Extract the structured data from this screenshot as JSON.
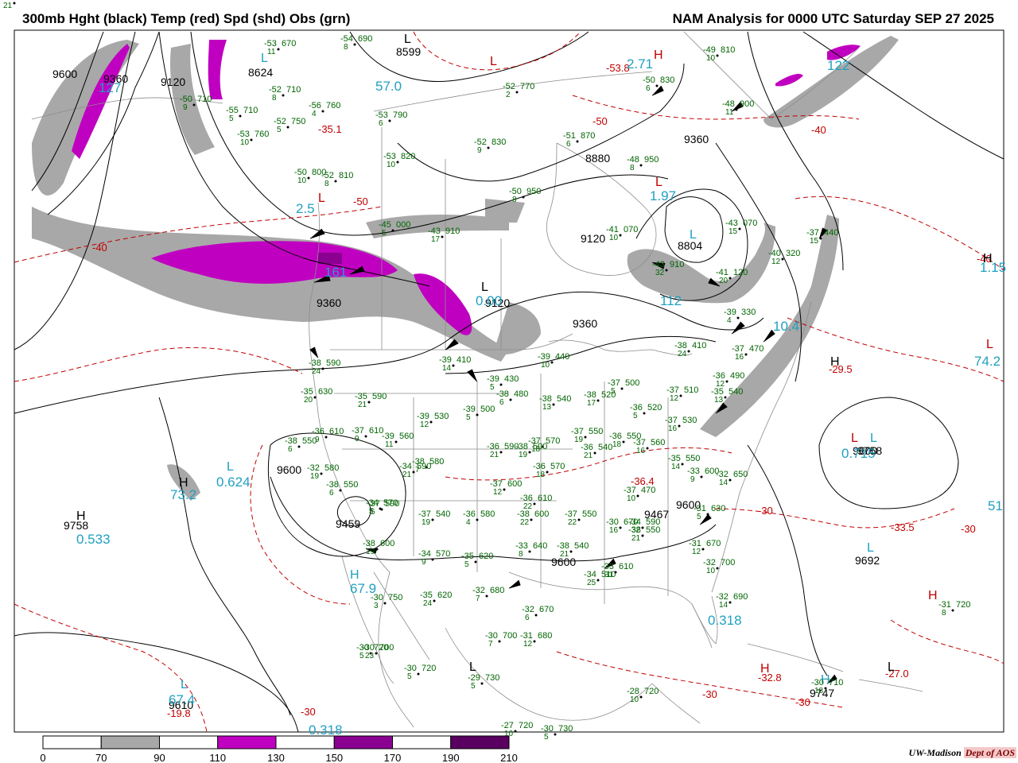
{
  "header": {
    "title_left": "300mb Hght (black) Temp (red) Spd (shd) Obs (grn)",
    "title_right": "NAM Analysis for 0000 UTC Saturday  SEP 27 2025"
  },
  "colorbar": {
    "ticks": [
      "0",
      "70",
      "90",
      "110",
      "130",
      "150",
      "170",
      "190",
      "210"
    ],
    "fills": [
      "#ffffff",
      "#a8a8a8",
      "#ffffff",
      "#c000c0",
      "#ffffff",
      "#8a0090",
      "#ffffff",
      "#5a0060"
    ]
  },
  "credit": {
    "org": "UW-Madison",
    "dept": "Dept of AOS"
  },
  "colors": {
    "height": "#000000",
    "temp": "#c00000",
    "obs": "#006400",
    "speed_label": "#20a0c0",
    "speed_90": "#a8a8a8",
    "speed_110": "#c000c0",
    "speed_150": "#8a0090"
  },
  "height_labels": [
    "9600",
    "9360",
    "9120",
    "8624",
    "8599",
    "8880",
    "9120",
    "9360",
    "8804",
    "9120",
    "9360",
    "9360",
    "9600",
    "9758",
    "9459",
    "9600",
    "9467",
    "9600",
    "9692",
    "9758",
    "9610",
    "9747",
    "9600"
  ],
  "temp_labels": [
    "-40",
    "-40",
    "-40",
    "-50",
    "-53.8",
    "-50",
    "-35.1",
    "-29.5",
    "-30",
    "-33.5",
    "-30",
    "-32.8",
    "-27.0",
    "-30",
    "-30",
    "-30",
    "-19.8",
    "-36.4"
  ],
  "speed_labels": [
    "57.0",
    "127",
    "2.71",
    "122",
    "1.97",
    "112",
    "1.15",
    "74.2",
    "0.624",
    "73.2",
    "0.533",
    "67.9",
    "0.318",
    "0.318",
    "0.715",
    "67.4",
    "51",
    "2.5",
    "161",
    "0.00",
    "10.4"
  ],
  "pressure_centers": [
    "H",
    "L",
    "L",
    "L",
    "H",
    "L",
    "H",
    "L",
    "L",
    "H",
    "L",
    "H",
    "L",
    "L",
    "L",
    "H",
    "H",
    "L",
    "L",
    "H",
    "H",
    "L",
    "L",
    "L"
  ],
  "obs": [
    {
      "t": "-53",
      "z": "670",
      "w": "11"
    },
    {
      "t": "-54",
      "z": "690",
      "w": "8"
    },
    {
      "t": "-52",
      "z": "710",
      "w": "8"
    },
    {
      "t": "-50",
      "z": "710",
      "w": "9"
    },
    {
      "t": "-55",
      "z": "710",
      "w": "5"
    },
    {
      "t": "-56",
      "z": "760",
      "w": "4"
    },
    {
      "t": "-52",
      "z": "750",
      "w": "5"
    },
    {
      "t": "-53",
      "z": "760",
      "w": "10"
    },
    {
      "t": "-52",
      "z": "770",
      "w": "2"
    },
    {
      "t": "-53",
      "z": "790",
      "w": "6"
    },
    {
      "t": "-52",
      "z": "830",
      "w": "9"
    },
    {
      "t": "-53",
      "z": "820",
      "w": "10"
    },
    {
      "t": "-50",
      "z": "800",
      "w": "10"
    },
    {
      "t": "-52",
      "z": "810",
      "w": "8"
    },
    {
      "t": "-50",
      "z": "950",
      "w": "8"
    },
    {
      "t": "-51",
      "z": "870",
      "w": "6"
    },
    {
      "t": "-48",
      "z": "950",
      "w": "8"
    },
    {
      "t": "-50",
      "z": "830",
      "w": "6"
    },
    {
      "t": "-49",
      "z": "810",
      "w": "10"
    },
    {
      "t": "-48",
      "z": "900",
      "w": "11"
    },
    {
      "t": "-41",
      "z": "070",
      "w": "10"
    },
    {
      "t": "-43",
      "z": "070",
      "w": "15"
    },
    {
      "t": "-45",
      "z": "000",
      "w": "5"
    },
    {
      "t": "-43",
      "z": "910",
      "w": "17"
    },
    {
      "t": "-43",
      "z": "910",
      "w": "32"
    },
    {
      "t": "-41",
      "z": "120",
      "w": "20"
    },
    {
      "t": "-40",
      "z": "320",
      "w": "12"
    },
    {
      "t": "-37",
      "z": "440",
      "w": "15"
    },
    {
      "t": "-39",
      "z": "330",
      "w": "4"
    },
    {
      "t": "-38",
      "z": "410",
      "w": "24"
    },
    {
      "t": "-39",
      "z": "410",
      "w": "14"
    },
    {
      "t": "-39",
      "z": "430",
      "w": "5"
    },
    {
      "t": "-39",
      "z": "440",
      "w": "10"
    },
    {
      "t": "-37",
      "z": "470",
      "w": "16"
    },
    {
      "t": "-36",
      "z": "490",
      "w": "12"
    },
    {
      "t": "-38",
      "z": "590",
      "w": "24"
    },
    {
      "t": "-35",
      "z": "630",
      "w": "20"
    },
    {
      "t": "-35",
      "z": "590",
      "w": "21"
    },
    {
      "t": "-39",
      "z": "530",
      "w": "12"
    },
    {
      "t": "-39",
      "z": "500",
      "w": "5"
    },
    {
      "t": "-38",
      "z": "480",
      "w": "6"
    },
    {
      "t": "-38",
      "z": "540",
      "w": "13"
    },
    {
      "t": "-38",
      "z": "520",
      "w": "17"
    },
    {
      "t": "-37",
      "z": "500",
      "w": "5"
    },
    {
      "t": "-36",
      "z": "520",
      "w": "5"
    },
    {
      "t": "-37",
      "z": "510",
      "w": "12"
    },
    {
      "t": "-37",
      "z": "530",
      "w": "16"
    },
    {
      "t": "-35",
      "z": "540",
      "w": "13"
    },
    {
      "t": "-36",
      "z": "610",
      "w": "9"
    },
    {
      "t": "-37",
      "z": "610",
      "w": "9"
    },
    {
      "t": "-39",
      "z": "560",
      "w": "11"
    },
    {
      "t": "-38",
      "z": "580",
      "w": "7"
    },
    {
      "t": "-37",
      "z": "570",
      "w": "18"
    },
    {
      "t": "-37",
      "z": "550",
      "w": "19"
    },
    {
      "t": "-36",
      "z": "540",
      "w": "21"
    },
    {
      "t": "-37",
      "z": "560",
      "w": "16"
    },
    {
      "t": "-38",
      "z": "550",
      "w": "6"
    },
    {
      "t": "-36",
      "z": "590",
      "w": "21"
    },
    {
      "t": "-36",
      "z": "570",
      "w": "18"
    },
    {
      "t": "-37",
      "z": "470",
      "w": "10"
    },
    {
      "t": "-35",
      "z": "550",
      "w": "14"
    },
    {
      "t": "-34",
      "z": "570",
      "w": "5"
    },
    {
      "t": "-33",
      "z": "600",
      "w": "9"
    },
    {
      "t": "-32",
      "z": "650",
      "w": "14"
    },
    {
      "t": "-31",
      "z": "630",
      "w": "5"
    },
    {
      "t": "-31",
      "z": "670",
      "w": "12"
    },
    {
      "t": "-32",
      "z": "700",
      "w": "10"
    },
    {
      "t": "-32",
      "z": "690",
      "w": "14"
    },
    {
      "t": "-31",
      "z": "720",
      "w": "8"
    },
    {
      "t": "-30",
      "z": "720",
      "w": "5"
    },
    {
      "t": "-30",
      "z": "710",
      "w": "18"
    },
    {
      "t": "-37",
      "z": "600",
      "w": "12"
    },
    {
      "t": "-38",
      "z": "600",
      "w": "22"
    },
    {
      "t": "-36",
      "z": "610",
      "w": "22"
    },
    {
      "t": "-37",
      "z": "550",
      "w": "22"
    },
    {
      "t": "-38",
      "z": "540",
      "w": "21"
    },
    {
      "t": "-34",
      "z": "590",
      "w": "32"
    },
    {
      "t": "-34",
      "z": "510",
      "w": "25"
    },
    {
      "t": "-33",
      "z": "610",
      "w": "31"
    },
    {
      "t": "-32",
      "z": "580",
      "w": "19"
    },
    {
      "t": "-38",
      "z": "550",
      "w": "6"
    },
    {
      "t": "-37",
      "z": "590",
      "w": "5"
    },
    {
      "t": "-37",
      "z": "540",
      "w": "19"
    },
    {
      "t": "-36",
      "z": "580",
      "w": "4"
    },
    {
      "t": "-38",
      "z": "600",
      "w": "19"
    },
    {
      "t": "-34",
      "z": "570",
      "w": "9"
    },
    {
      "t": "-35",
      "z": "620",
      "w": "5"
    },
    {
      "t": "-33",
      "z": "640",
      "w": "8"
    },
    {
      "t": "-35",
      "z": "620",
      "w": "24"
    },
    {
      "t": "-32",
      "z": "680",
      "w": "7"
    },
    {
      "t": "-32",
      "z": "670",
      "w": "6"
    },
    {
      "t": "-31",
      "z": "680",
      "w": "12"
    },
    {
      "t": "-30",
      "z": "700",
      "w": "7"
    },
    {
      "t": "-30",
      "z": "700",
      "w": "23"
    },
    {
      "t": "-30",
      "z": "720",
      "w": "5"
    },
    {
      "t": "-29",
      "z": "730",
      "w": "5"
    },
    {
      "t": "-27",
      "z": "720",
      "w": "10"
    },
    {
      "t": "-30",
      "z": "730",
      "w": "5"
    },
    {
      "t": "-28",
      "z": "720",
      "w": "10"
    },
    {
      "t": "-30",
      "z": "750",
      "w": "3"
    },
    {
      "t": "-30",
      "z": "670",
      "w": "16"
    },
    {
      "t": "-34",
      "z": "590",
      "w": "21"
    },
    {
      "t": "-38",
      "z": "550",
      "w": "21"
    },
    {
      "t": "-36",
      "z": "550",
      "w": "18"
    },
    {
      "t": "-38",
      "z": "500",
      "w": "19"
    },
    {
      "t": "-36",
      "z": "600",
      "w": "21"
    }
  ]
}
